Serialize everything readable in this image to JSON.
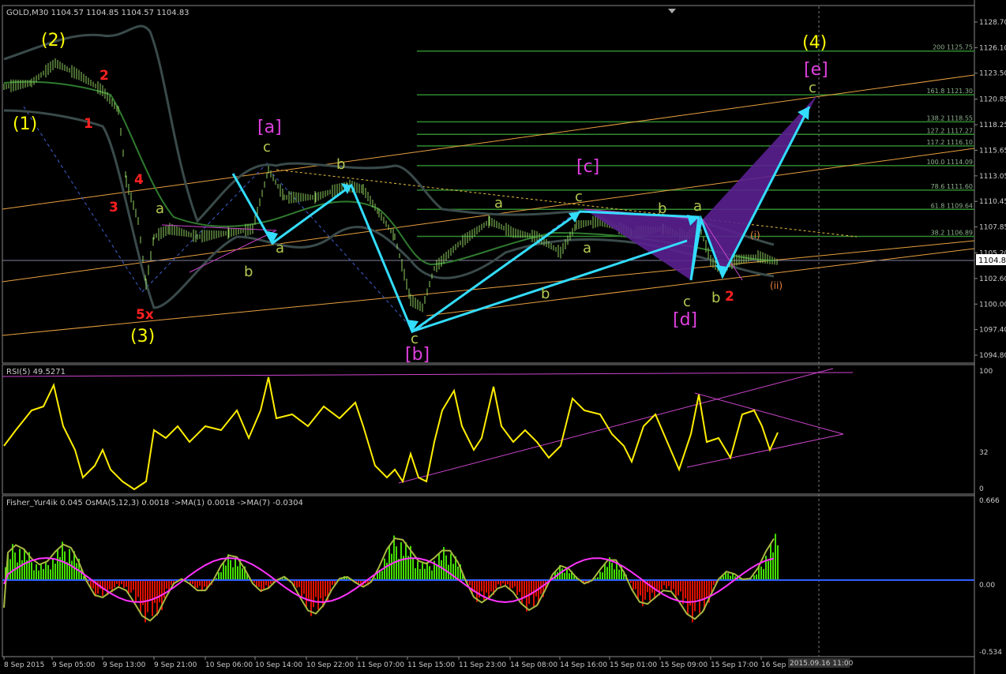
{
  "symbol_header": "GOLD,M30  1104.57 1104.85 1104.57 1104.83",
  "current_price": "1104.83",
  "price_axis": [
    "1128.70",
    "1126.10",
    "1123.50",
    "1120.85",
    "1118.25",
    "1115.65",
    "1113.05",
    "1110.45",
    "1107.85",
    "1105.20",
    "1102.60",
    "1100.00",
    "1097.40",
    "1094.80"
  ],
  "fib_levels": [
    {
      "label": "200  1125.75",
      "price": 1125.75
    },
    {
      "label": "161.8  1121.30",
      "price": 1121.3
    },
    {
      "label": "138.2  1118.55",
      "price": 1118.55
    },
    {
      "label": "127.2  1117.27",
      "price": 1117.27
    },
    {
      "label": "117.2  1116.10",
      "price": 1116.1
    },
    {
      "label": "100.0  1114.09",
      "price": 1114.09
    },
    {
      "label": "78.6  1111.60",
      "price": 1111.6
    },
    {
      "label": "61.8  1109.64",
      "price": 1109.64
    },
    {
      "label": "38.2  1106.89",
      "price": 1106.89
    }
  ],
  "rsi": {
    "header": "RSI(5) 49.5271",
    "axis": [
      "100",
      "32",
      "0"
    ]
  },
  "fisher": {
    "header": "Fisher_Yur4ik 0.045  OsMA(5,12,3) 0.0018  ->MA(1) 0.0018  ->MA(7) -0.0304",
    "axis": [
      "0.666",
      "0.00",
      "-0.534"
    ]
  },
  "time_axis": [
    "8 Sep 2015",
    "9 Sep 05:00",
    "9 Sep 13:00",
    "9 Sep 21:00",
    "10 Sep 06:00",
    "10 Sep 14:00",
    "10 Sep 22:00",
    "11 Sep 07:00",
    "11 Sep 15:00",
    "11 Sep 23:00",
    "14 Sep 08:00",
    "14 Sep 16:00",
    "15 Sep 01:00",
    "15 Sep 09:00",
    "15 Sep 17:00",
    "16 Sep"
  ],
  "crosshair_time": "2015.09.16 11:00",
  "wave_labels": {
    "w2": "(2)",
    "w1": "(1)",
    "w3": "(3)",
    "w4": "(4)",
    "w5x": "5x",
    "r2": "2",
    "r1": "1",
    "r4": "4",
    "r3": "3",
    "r2b": "2",
    "ba": "[a]",
    "bb": "[b]",
    "bc": "[c]",
    "bd": "[d]",
    "be": "[e]",
    "c": "c",
    "b": "b",
    "a": "a",
    "wi": "(i)",
    "wii": "(ii)"
  },
  "colors": {
    "yellow": "#ffff00",
    "magenta": "#e040e0",
    "red": "#ff0000",
    "cyan": "#33ddff",
    "olive": "#b5c850",
    "green": "#33cc00"
  }
}
